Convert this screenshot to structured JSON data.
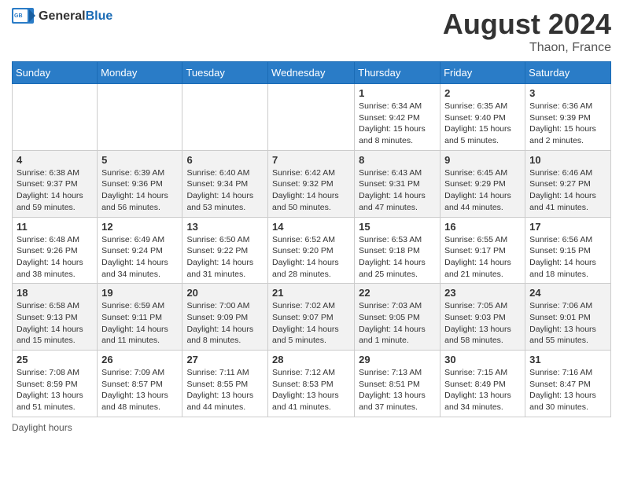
{
  "header": {
    "logo_general": "General",
    "logo_blue": "Blue",
    "month_year": "August 2024",
    "location": "Thaon, France"
  },
  "days_of_week": [
    "Sunday",
    "Monday",
    "Tuesday",
    "Wednesday",
    "Thursday",
    "Friday",
    "Saturday"
  ],
  "weeks": [
    [
      {
        "day": "",
        "info": ""
      },
      {
        "day": "",
        "info": ""
      },
      {
        "day": "",
        "info": ""
      },
      {
        "day": "",
        "info": ""
      },
      {
        "day": "1",
        "info": "Sunrise: 6:34 AM\nSunset: 9:42 PM\nDaylight: 15 hours\nand 8 minutes."
      },
      {
        "day": "2",
        "info": "Sunrise: 6:35 AM\nSunset: 9:40 PM\nDaylight: 15 hours\nand 5 minutes."
      },
      {
        "day": "3",
        "info": "Sunrise: 6:36 AM\nSunset: 9:39 PM\nDaylight: 15 hours\nand 2 minutes."
      }
    ],
    [
      {
        "day": "4",
        "info": "Sunrise: 6:38 AM\nSunset: 9:37 PM\nDaylight: 14 hours\nand 59 minutes."
      },
      {
        "day": "5",
        "info": "Sunrise: 6:39 AM\nSunset: 9:36 PM\nDaylight: 14 hours\nand 56 minutes."
      },
      {
        "day": "6",
        "info": "Sunrise: 6:40 AM\nSunset: 9:34 PM\nDaylight: 14 hours\nand 53 minutes."
      },
      {
        "day": "7",
        "info": "Sunrise: 6:42 AM\nSunset: 9:32 PM\nDaylight: 14 hours\nand 50 minutes."
      },
      {
        "day": "8",
        "info": "Sunrise: 6:43 AM\nSunset: 9:31 PM\nDaylight: 14 hours\nand 47 minutes."
      },
      {
        "day": "9",
        "info": "Sunrise: 6:45 AM\nSunset: 9:29 PM\nDaylight: 14 hours\nand 44 minutes."
      },
      {
        "day": "10",
        "info": "Sunrise: 6:46 AM\nSunset: 9:27 PM\nDaylight: 14 hours\nand 41 minutes."
      }
    ],
    [
      {
        "day": "11",
        "info": "Sunrise: 6:48 AM\nSunset: 9:26 PM\nDaylight: 14 hours\nand 38 minutes."
      },
      {
        "day": "12",
        "info": "Sunrise: 6:49 AM\nSunset: 9:24 PM\nDaylight: 14 hours\nand 34 minutes."
      },
      {
        "day": "13",
        "info": "Sunrise: 6:50 AM\nSunset: 9:22 PM\nDaylight: 14 hours\nand 31 minutes."
      },
      {
        "day": "14",
        "info": "Sunrise: 6:52 AM\nSunset: 9:20 PM\nDaylight: 14 hours\nand 28 minutes."
      },
      {
        "day": "15",
        "info": "Sunrise: 6:53 AM\nSunset: 9:18 PM\nDaylight: 14 hours\nand 25 minutes."
      },
      {
        "day": "16",
        "info": "Sunrise: 6:55 AM\nSunset: 9:17 PM\nDaylight: 14 hours\nand 21 minutes."
      },
      {
        "day": "17",
        "info": "Sunrise: 6:56 AM\nSunset: 9:15 PM\nDaylight: 14 hours\nand 18 minutes."
      }
    ],
    [
      {
        "day": "18",
        "info": "Sunrise: 6:58 AM\nSunset: 9:13 PM\nDaylight: 14 hours\nand 15 minutes."
      },
      {
        "day": "19",
        "info": "Sunrise: 6:59 AM\nSunset: 9:11 PM\nDaylight: 14 hours\nand 11 minutes."
      },
      {
        "day": "20",
        "info": "Sunrise: 7:00 AM\nSunset: 9:09 PM\nDaylight: 14 hours\nand 8 minutes."
      },
      {
        "day": "21",
        "info": "Sunrise: 7:02 AM\nSunset: 9:07 PM\nDaylight: 14 hours\nand 5 minutes."
      },
      {
        "day": "22",
        "info": "Sunrise: 7:03 AM\nSunset: 9:05 PM\nDaylight: 14 hours\nand 1 minute."
      },
      {
        "day": "23",
        "info": "Sunrise: 7:05 AM\nSunset: 9:03 PM\nDaylight: 13 hours\nand 58 minutes."
      },
      {
        "day": "24",
        "info": "Sunrise: 7:06 AM\nSunset: 9:01 PM\nDaylight: 13 hours\nand 55 minutes."
      }
    ],
    [
      {
        "day": "25",
        "info": "Sunrise: 7:08 AM\nSunset: 8:59 PM\nDaylight: 13 hours\nand 51 minutes."
      },
      {
        "day": "26",
        "info": "Sunrise: 7:09 AM\nSunset: 8:57 PM\nDaylight: 13 hours\nand 48 minutes."
      },
      {
        "day": "27",
        "info": "Sunrise: 7:11 AM\nSunset: 8:55 PM\nDaylight: 13 hours\nand 44 minutes."
      },
      {
        "day": "28",
        "info": "Sunrise: 7:12 AM\nSunset: 8:53 PM\nDaylight: 13 hours\nand 41 minutes."
      },
      {
        "day": "29",
        "info": "Sunrise: 7:13 AM\nSunset: 8:51 PM\nDaylight: 13 hours\nand 37 minutes."
      },
      {
        "day": "30",
        "info": "Sunrise: 7:15 AM\nSunset: 8:49 PM\nDaylight: 13 hours\nand 34 minutes."
      },
      {
        "day": "31",
        "info": "Sunrise: 7:16 AM\nSunset: 8:47 PM\nDaylight: 13 hours\nand 30 minutes."
      }
    ]
  ],
  "footer": {
    "daylight_label": "Daylight hours"
  }
}
